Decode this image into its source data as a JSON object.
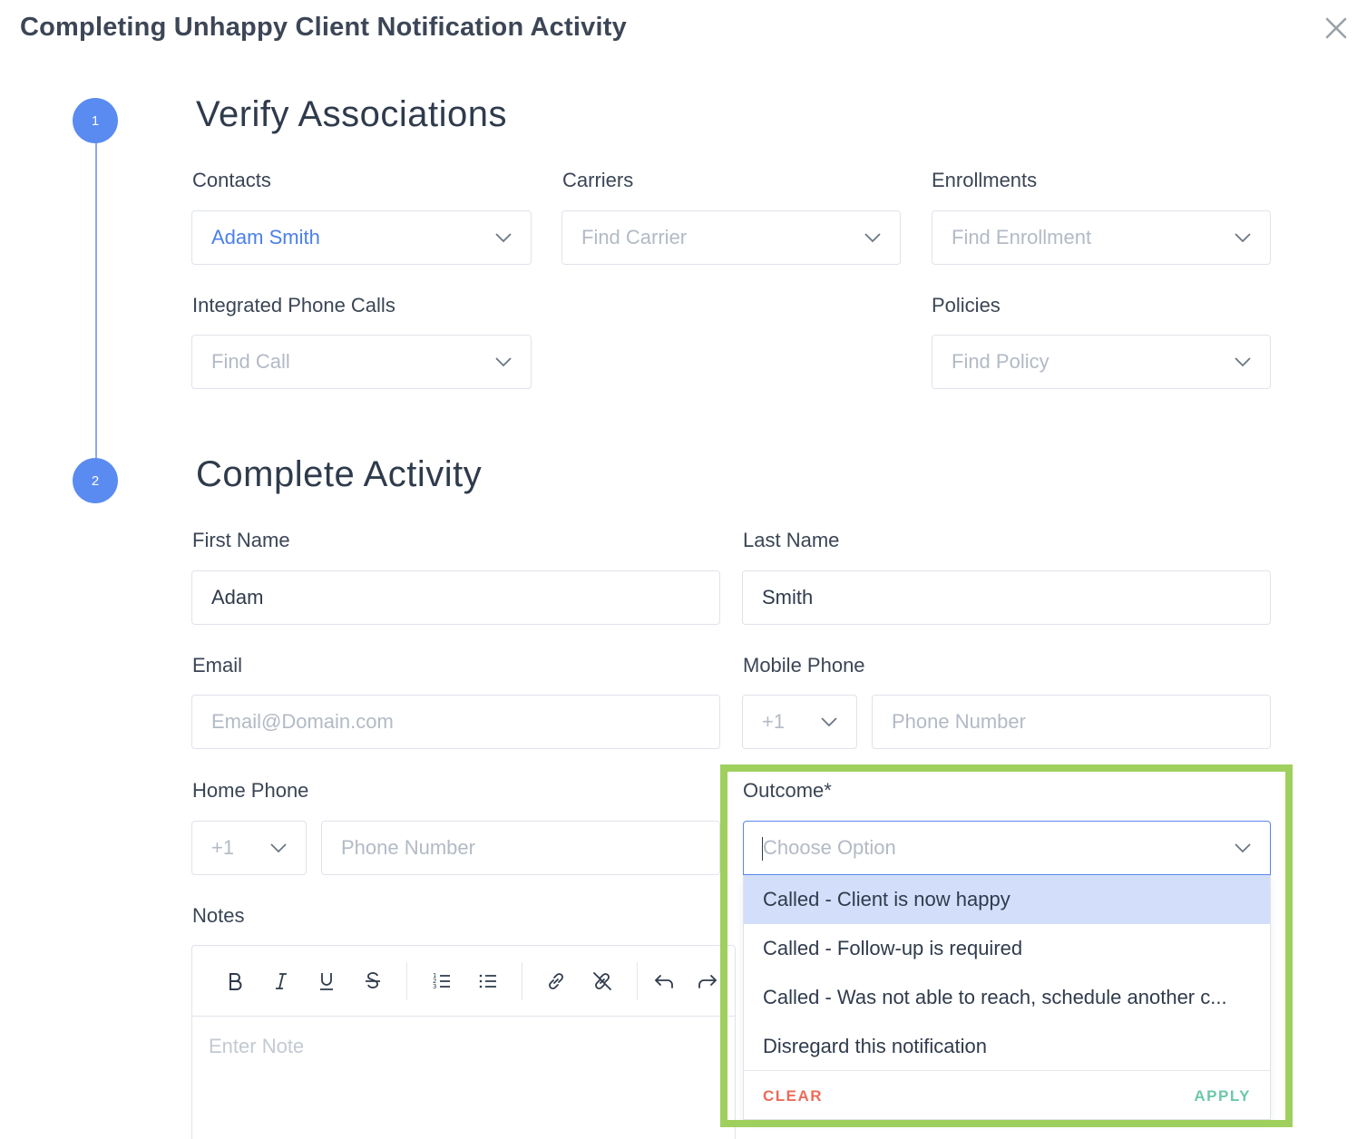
{
  "modal": {
    "title": "Completing Unhappy Client Notification Activity"
  },
  "steps": [
    {
      "number": "1",
      "title": "Verify Associations"
    },
    {
      "number": "2",
      "title": "Complete Activity"
    }
  ],
  "associations": {
    "contacts": {
      "label": "Contacts",
      "value": "Adam Smith"
    },
    "carriers": {
      "label": "Carriers",
      "placeholder": "Find Carrier"
    },
    "enrollments": {
      "label": "Enrollments",
      "placeholder": "Find Enrollment"
    },
    "phone_calls": {
      "label": "Integrated Phone Calls",
      "placeholder": "Find Call"
    },
    "policies": {
      "label": "Policies",
      "placeholder": "Find Policy"
    }
  },
  "activity": {
    "first_name": {
      "label": "First Name",
      "value": "Adam"
    },
    "last_name": {
      "label": "Last Name",
      "value": "Smith"
    },
    "email": {
      "label": "Email",
      "placeholder": "Email@Domain.com"
    },
    "mobile_phone": {
      "label": "Mobile Phone",
      "country_code": "+1",
      "placeholder": "Phone Number"
    },
    "home_phone": {
      "label": "Home Phone",
      "country_code": "+1",
      "placeholder": "Phone Number"
    },
    "notes": {
      "label": "Notes",
      "placeholder": "Enter Note"
    },
    "outcome": {
      "label": "Outcome*",
      "placeholder": "Choose Option",
      "options": [
        "Called - Client is now happy",
        "Called - Follow-up is required",
        "Called - Was not able to reach, schedule another c...",
        "Disregard this notification"
      ],
      "highlighted_index": 0,
      "clear_label": "CLEAR",
      "apply_label": "APPLY"
    }
  },
  "icons": {
    "close": "close-icon",
    "chevron": "chevron-down-icon",
    "toolbar": [
      "bold-icon",
      "italic-icon",
      "underline-icon",
      "strikethrough-icon",
      "ordered-list-icon",
      "bullet-list-icon",
      "link-icon",
      "unlink-icon",
      "undo-icon",
      "redo-icon"
    ]
  },
  "colors": {
    "accent": "#5a8bf0",
    "link": "#4a80e8",
    "highlight_border": "#9fd05e",
    "option_active": "#d3defa",
    "clear": "#ec6b5a",
    "apply": "#6cc8a8"
  }
}
